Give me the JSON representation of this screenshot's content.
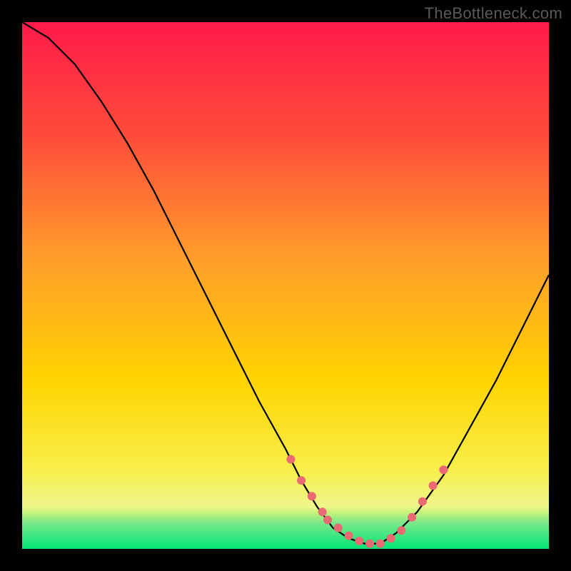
{
  "watermark": "TheBottleneck.com",
  "chart_data": {
    "type": "line",
    "title": "",
    "xlabel": "",
    "ylabel": "",
    "xlim": [
      0,
      100
    ],
    "ylim": [
      0,
      100
    ],
    "curve": {
      "name": "bottleneck-curve",
      "x": [
        0,
        5,
        10,
        15,
        20,
        25,
        30,
        35,
        40,
        45,
        50,
        53,
        56,
        59,
        62,
        65,
        68,
        71,
        75,
        80,
        85,
        90,
        95,
        100
      ],
      "y": [
        100,
        97,
        92,
        85,
        77,
        68,
        58,
        48,
        38,
        28,
        19,
        13,
        8,
        4,
        2,
        1,
        1,
        3,
        7,
        14,
        23,
        32,
        42,
        52
      ]
    },
    "markers": {
      "name": "highlight-dots",
      "x": [
        51,
        53,
        55,
        57,
        58,
        60,
        62,
        64,
        66,
        68,
        70,
        72,
        74,
        76,
        78,
        80
      ],
      "y": [
        17,
        13,
        10,
        7,
        5.5,
        4,
        2.5,
        1.5,
        1,
        1,
        2,
        3.5,
        6,
        9,
        12,
        15
      ],
      "color": "#e96a72",
      "radius": 6
    },
    "background_gradient": {
      "top_color": "#ff1a4a",
      "mid_color": "#ffd400",
      "bottom_band_color": "#00e676",
      "bottom_band_start_pct": 93
    }
  }
}
